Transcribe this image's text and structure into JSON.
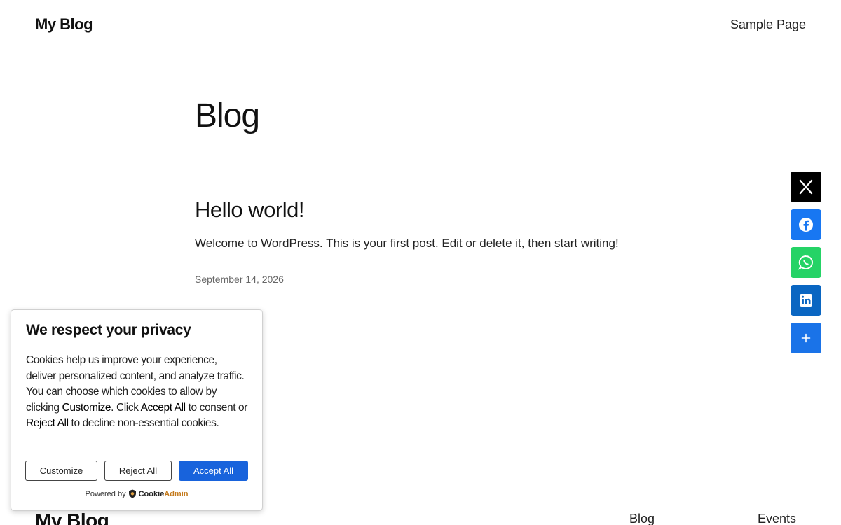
{
  "header": {
    "site_title": "My Blog",
    "nav_link": "Sample Page"
  },
  "main": {
    "page_title": "Blog",
    "posts": [
      {
        "title": "Hello world!",
        "excerpt": "Welcome to WordPress. This is your first post. Edit or delete it, then start writing!",
        "date": "September 14, 2026"
      }
    ]
  },
  "share_bar": {
    "buttons": [
      {
        "name": "x",
        "icon": "x-icon",
        "color": "#000000"
      },
      {
        "name": "facebook",
        "icon": "facebook-icon",
        "color": "#1877f2"
      },
      {
        "name": "whatsapp",
        "icon": "whatsapp-icon",
        "color": "#25d366"
      },
      {
        "name": "linkedin",
        "icon": "linkedin-icon",
        "color": "#0a66c2"
      },
      {
        "name": "more",
        "icon": "plus-icon",
        "color": "#1a73e8"
      }
    ]
  },
  "cookie_banner": {
    "heading": "We respect your privacy",
    "text_1": "Cookies help us improve your experience, deliver personalized content, and analyze traffic. You can choose which cookies to allow by clicking ",
    "customize_term": "Customize",
    "text_2": ". Click ",
    "accept_term": "Accept All",
    "text_3": " to consent or ",
    "reject_term": "Reject All",
    "text_4": " to decline non-essential cookies.",
    "customize_label": "Customize",
    "reject_label": "Reject All",
    "accept_label": "Accept All",
    "powered_by": "Powered by",
    "brand_part_1": "Cookie",
    "brand_part_2": "Admin",
    "accent_color": "#1863dc"
  },
  "footer": {
    "site_title": "My Blog",
    "links": [
      "Blog",
      "Events"
    ]
  }
}
